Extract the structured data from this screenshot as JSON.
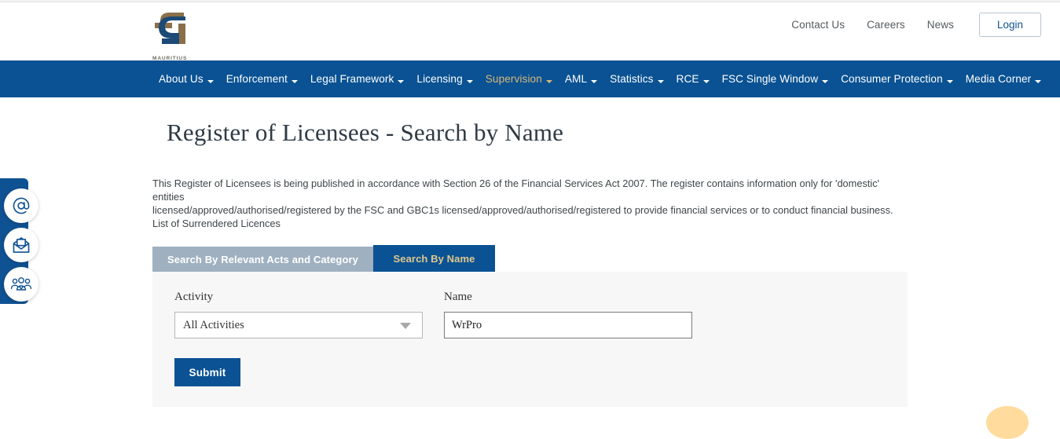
{
  "header": {
    "logo": {
      "name": "fsc-mauritius-logo",
      "caption": "MAURITIUS",
      "color_gold": "#8a7048",
      "color_blue": "#1b4a77"
    },
    "links": [
      {
        "label": "Contact Us",
        "name": "contact-us-link"
      },
      {
        "label": "Careers",
        "name": "careers-link"
      },
      {
        "label": "News",
        "name": "news-link"
      }
    ],
    "login_label": "Login"
  },
  "mainnav": {
    "background": "#0a5293",
    "active_color": "#d9b779",
    "items": [
      {
        "label": "About Us",
        "has_caret": true,
        "active": false
      },
      {
        "label": "Enforcement",
        "has_caret": true,
        "active": false
      },
      {
        "label": "Legal Framework",
        "has_caret": true,
        "active": false
      },
      {
        "label": "Licensing",
        "has_caret": true,
        "active": false
      },
      {
        "label": "Supervision",
        "has_caret": true,
        "active": true
      },
      {
        "label": "AML",
        "has_caret": true,
        "active": false
      },
      {
        "label": "Statistics",
        "has_caret": true,
        "active": false
      },
      {
        "label": "RCE",
        "has_caret": true,
        "active": false
      },
      {
        "label": "FSC Single Window",
        "has_caret": true,
        "active": false
      },
      {
        "label": "Consumer Protection",
        "has_caret": true,
        "active": false
      },
      {
        "label": "Media Corner",
        "has_caret": true,
        "active": false
      }
    ]
  },
  "page": {
    "title": "Register of Licensees - Search by Name",
    "intro_line1": "This Register of Licensees is being published in accordance with Section 26 of the Financial Services Act 2007. The register contains information only for 'domestic' entities",
    "intro_line2": "licensed/approved/authorised/registered by the FSC and GBC1s licensed/approved/authorised/registered to provide financial services or to conduct financial business.",
    "intro_line3": "List of Surrendered Licences"
  },
  "tabs": [
    {
      "label": "Search By Relevant Acts and Category",
      "active": false,
      "name": "tab-search-by-acts-category"
    },
    {
      "label": "Search By Name",
      "active": true,
      "name": "tab-search-by-name"
    }
  ],
  "form": {
    "activity": {
      "label": "Activity",
      "selected": "All Activities"
    },
    "name": {
      "label": "Name",
      "value": "WrPro",
      "placeholder": ""
    },
    "submit_label": "Submit"
  },
  "social_rail": {
    "items": [
      {
        "name": "at-sign-icon",
        "title": "Email"
      },
      {
        "name": "envelope-icon",
        "title": "Contact"
      },
      {
        "name": "people-group-icon",
        "title": "Community"
      }
    ],
    "color": "#0f5293"
  }
}
